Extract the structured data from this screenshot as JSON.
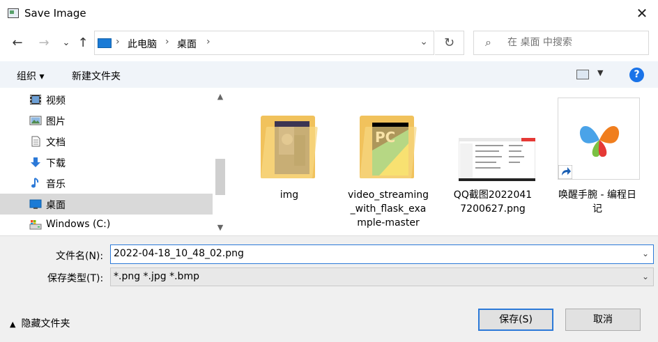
{
  "window": {
    "title": "Save Image"
  },
  "nav": {
    "back": "←",
    "forward": "→",
    "recent": "⌄",
    "up": "↑",
    "breadcrumb": [
      "此电脑",
      "桌面"
    ],
    "refresh": "↻",
    "search_placeholder": "在 桌面 中搜索"
  },
  "toolbar": {
    "organize": "组织 ▾",
    "new_folder": "新建文件夹",
    "help": "?"
  },
  "sidebar": {
    "items": [
      {
        "label": "视频",
        "icon": "video-icon"
      },
      {
        "label": "图片",
        "icon": "picture-icon"
      },
      {
        "label": "文档",
        "icon": "document-icon"
      },
      {
        "label": "下载",
        "icon": "download-icon"
      },
      {
        "label": "音乐",
        "icon": "music-icon"
      },
      {
        "label": "桌面",
        "icon": "desktop-icon",
        "selected": true
      },
      {
        "label": "Windows  (C:)",
        "icon": "drive-icon"
      }
    ]
  },
  "files": [
    {
      "name": "img",
      "type": "folder"
    },
    {
      "name": "video_streaming_with_flask_example-master",
      "type": "folder"
    },
    {
      "name": "QQ截图20220417200627.png",
      "type": "image"
    },
    {
      "name": "唤醒手腕 - 编程日记",
      "type": "shortcut"
    }
  ],
  "form": {
    "filename_label": "文件名(N):",
    "filename_value": "2022-04-18_10_48_02.png",
    "filetype_label": "保存类型(T):",
    "filetype_value": "*.png *.jpg *.bmp"
  },
  "footer": {
    "hide_folders": "隐藏文件夹",
    "save": "保存(S)",
    "cancel": "取消"
  },
  "colors": {
    "accent": "#2b79d8",
    "toolbar_bg": "#f0f4f9",
    "selected_bg": "#d9d9d9",
    "folder": "#f1c25c"
  }
}
